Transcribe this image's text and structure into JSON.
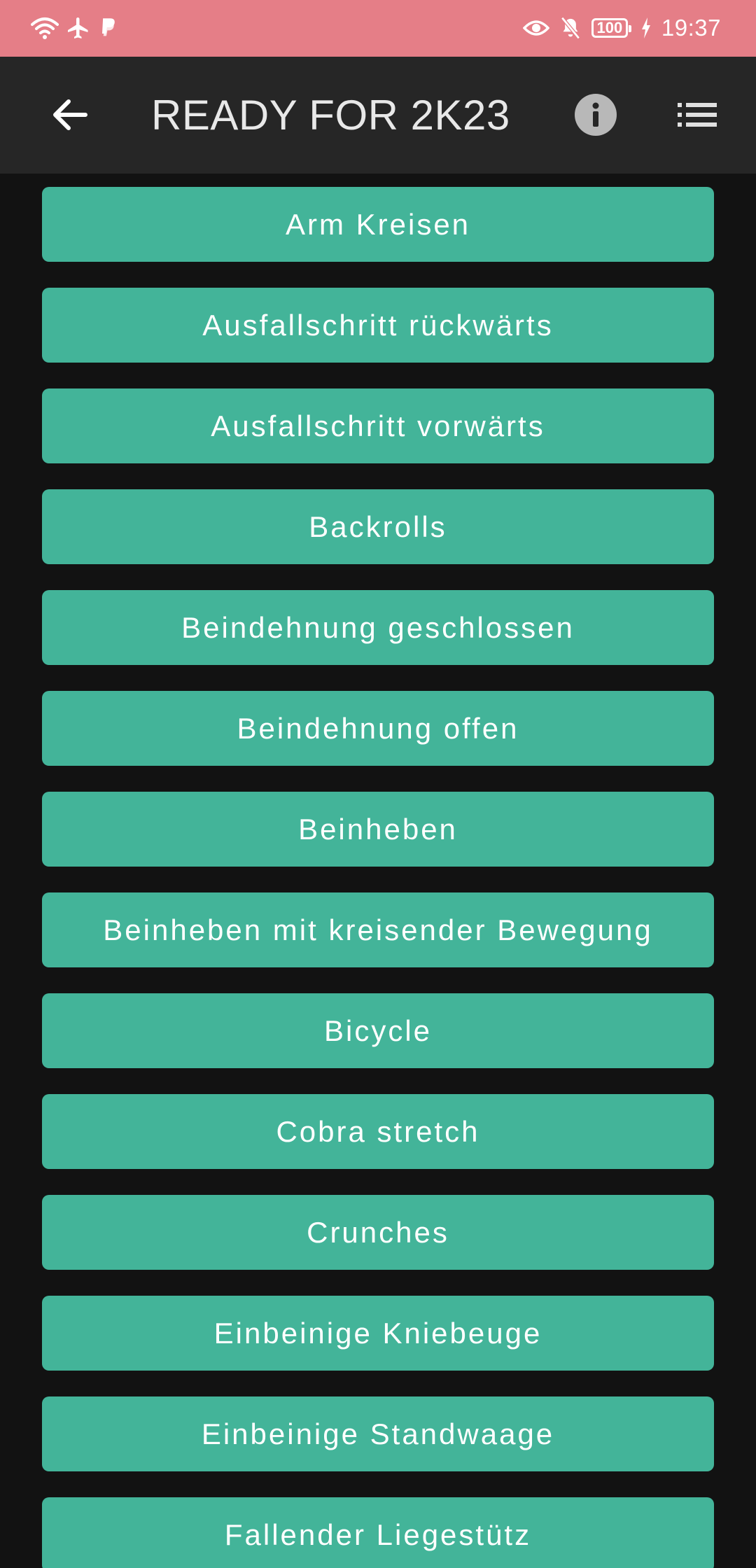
{
  "status_bar": {
    "time": "19:37",
    "battery": "100",
    "left_icons": [
      "wifi-icon",
      "airplane-icon",
      "paypal-icon"
    ],
    "right_icons": [
      "eye-icon",
      "bell-off-icon",
      "battery-icon",
      "charging-icon"
    ],
    "background": "#e57e87"
  },
  "app_bar": {
    "title": "READY FOR 2K23",
    "background": "#262626",
    "back_icon": "arrow-left-icon",
    "info_icon": "info-icon",
    "list_icon": "list-icon"
  },
  "exercises": [
    "Arm Kreisen",
    "Ausfallschritt rückwärts",
    "Ausfallschritt vorwärts",
    "Backrolls",
    "Beindehnung geschlossen",
    "Beindehnung offen",
    "Beinheben",
    "Beinheben mit kreisender Bewegung",
    "Bicycle",
    "Cobra stretch",
    "Crunches",
    "Einbeinige Kniebeuge",
    "Einbeinige Standwaage",
    "Fallender Liegestütz"
  ],
  "colors": {
    "button": "#43b499",
    "page_background": "#121212"
  }
}
